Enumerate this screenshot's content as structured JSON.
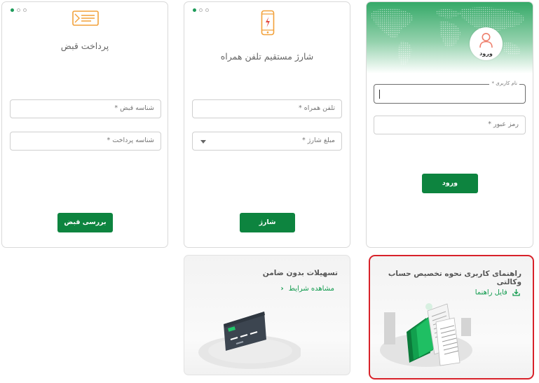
{
  "bill_card": {
    "title": "پرداخت قبض",
    "bill_id_placeholder": "شناسه قبض *",
    "payment_id_placeholder": "شناسه پرداخت *",
    "submit_label": "بررسی قبض",
    "icon": "bill-icon"
  },
  "charge_card": {
    "title": "شارژ مستقیم تلفن همراه",
    "phone_placeholder": "تلفن همراه *",
    "amount_placeholder": "مبلغ شارژ *",
    "submit_label": "شارژ",
    "icon": "mobile-charge-icon"
  },
  "login_card": {
    "avatar_label": "ورود",
    "username_label": "نام کاربری *",
    "password_placeholder": "رمز عبور *",
    "submit_label": "ورود",
    "icon": "user-icon"
  },
  "loan_card": {
    "title": "تسهیلات بدون ضامن",
    "link_label": "مشاهده شرایط",
    "icon": "chevron-left-icon"
  },
  "guide_card": {
    "title": "راهنمای کاربری نحوه تخصیص حساب وکالتی",
    "link_label": "فایل راهنما",
    "icon": "download-icon"
  },
  "colors": {
    "primary_button": "#0d843f",
    "accent": "#1e9b5a",
    "link": "#119b4e",
    "highlight_border": "#d8222a",
    "icon_orange": "#f2a13a"
  }
}
